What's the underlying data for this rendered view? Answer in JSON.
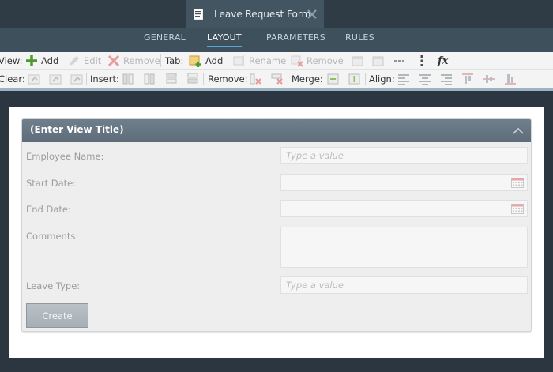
{
  "document": {
    "title": "Leave Request Form"
  },
  "nav_tabs": [
    {
      "label": "GENERAL"
    },
    {
      "label": "LAYOUT",
      "active": true
    },
    {
      "label": "PARAMETERS"
    },
    {
      "label": "RULES"
    }
  ],
  "toolbar": {
    "view_label": "View:",
    "view_add": "Add",
    "view_edit": "Edit",
    "view_remove": "Remove",
    "tab_label": "Tab:",
    "tab_add": "Add",
    "tab_rename": "Rename",
    "tab_remove": "Remove",
    "clear_label": "Clear:",
    "insert_label": "Insert:",
    "remove_label": "Remove:",
    "merge_label": "Merge:",
    "align_label": "Align:",
    "fx_label": "fx"
  },
  "form": {
    "title": "(Enter View Title)",
    "fields": [
      {
        "label": "Employee Name:",
        "placeholder": "Type a value"
      },
      {
        "label": "Start Date:",
        "placeholder": ""
      },
      {
        "label": "End Date:",
        "placeholder": ""
      },
      {
        "label": "Comments:",
        "placeholder": ""
      },
      {
        "label": "Leave Type:",
        "placeholder": "Type a value"
      }
    ],
    "create_button": "Create"
  },
  "colors": {
    "accent": "#5aa6d8",
    "header": "#5d6c78",
    "add_green": "#4c9a2a",
    "remove_red": "#d9534f"
  }
}
